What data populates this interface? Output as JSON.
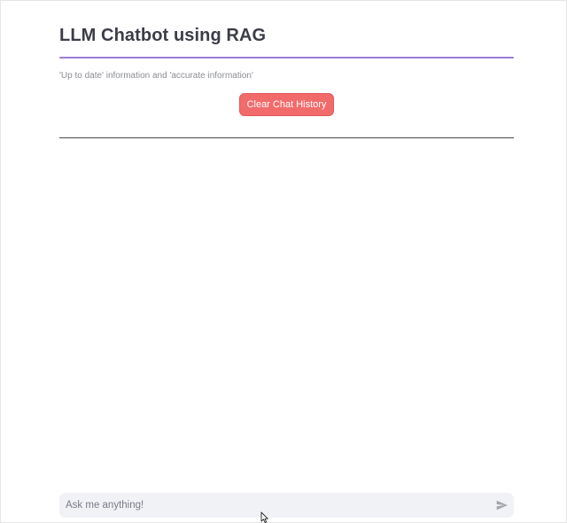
{
  "app": {
    "title": "LLM Chatbot using RAG",
    "caption": "'Up to date' information and 'accurate information'"
  },
  "actions": {
    "clear_label": "Clear Chat History"
  },
  "chat": {
    "messages": [],
    "input_placeholder": "Ask me anything!",
    "input_value": ""
  },
  "icons": {
    "send": "send-icon",
    "pointer": "mouse-pointer-icon"
  },
  "colors": {
    "accent_rule": "#9a7cd6",
    "clear_button": "#f26b6b",
    "input_background": "#f0f2f6"
  }
}
